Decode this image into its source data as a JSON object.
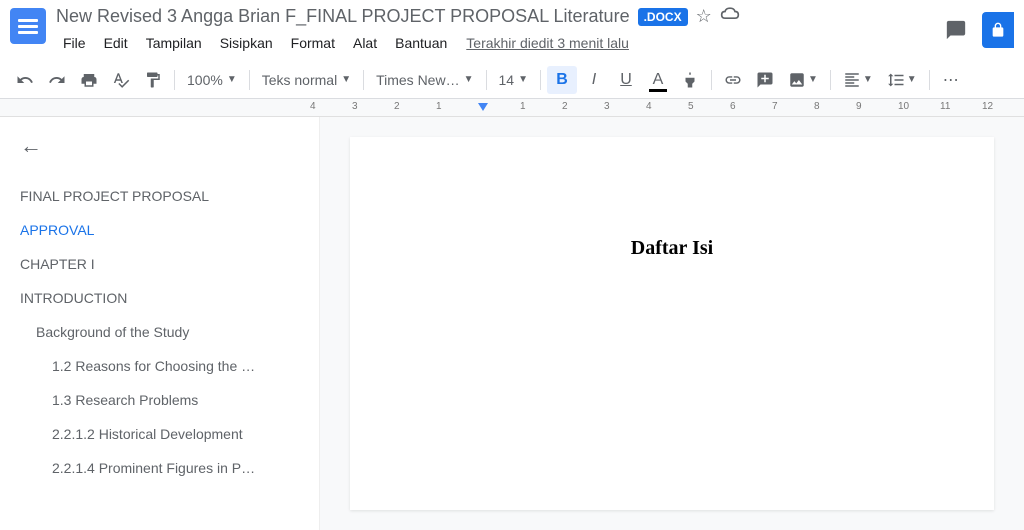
{
  "header": {
    "title": "New Revised 3 Angga Brian F_FINAL PROJECT PROPOSAL Literature",
    "badge": ".DOCX",
    "last_edit": "Terakhir diedit 3 menit lalu"
  },
  "menu": {
    "file": "File",
    "edit": "Edit",
    "view": "Tampilan",
    "insert": "Sisipkan",
    "format": "Format",
    "tools": "Alat",
    "help": "Bantuan"
  },
  "toolbar": {
    "zoom": "100%",
    "style": "Teks normal",
    "font": "Times New…",
    "size": "14"
  },
  "outline": {
    "items": [
      {
        "label": "FINAL PROJECT PROPOSAL",
        "level": 0,
        "active": false
      },
      {
        "label": "APPROVAL",
        "level": 0,
        "active": true
      },
      {
        "label": "CHAPTER I",
        "level": 0,
        "active": false
      },
      {
        "label": "INTRODUCTION",
        "level": 0,
        "active": false
      },
      {
        "label": "Background of the Study",
        "level": 1,
        "active": false
      },
      {
        "label": "1.2 Reasons for Choosing the …",
        "level": 2,
        "active": false
      },
      {
        "label": "1.3 Research Problems",
        "level": 2,
        "active": false
      },
      {
        "label": "2.2.1.2 Historical Development",
        "level": 2,
        "active": false
      },
      {
        "label": "2.2.1.4 Prominent Figures in P…",
        "level": 2,
        "active": false
      }
    ]
  },
  "document": {
    "heading": "Daftar Isi"
  },
  "ruler": {
    "marks": [
      "4",
      "3",
      "2",
      "1",
      "",
      "1",
      "2",
      "3",
      "4",
      "5",
      "6",
      "7",
      "8",
      "9",
      "10",
      "11",
      "12"
    ]
  }
}
